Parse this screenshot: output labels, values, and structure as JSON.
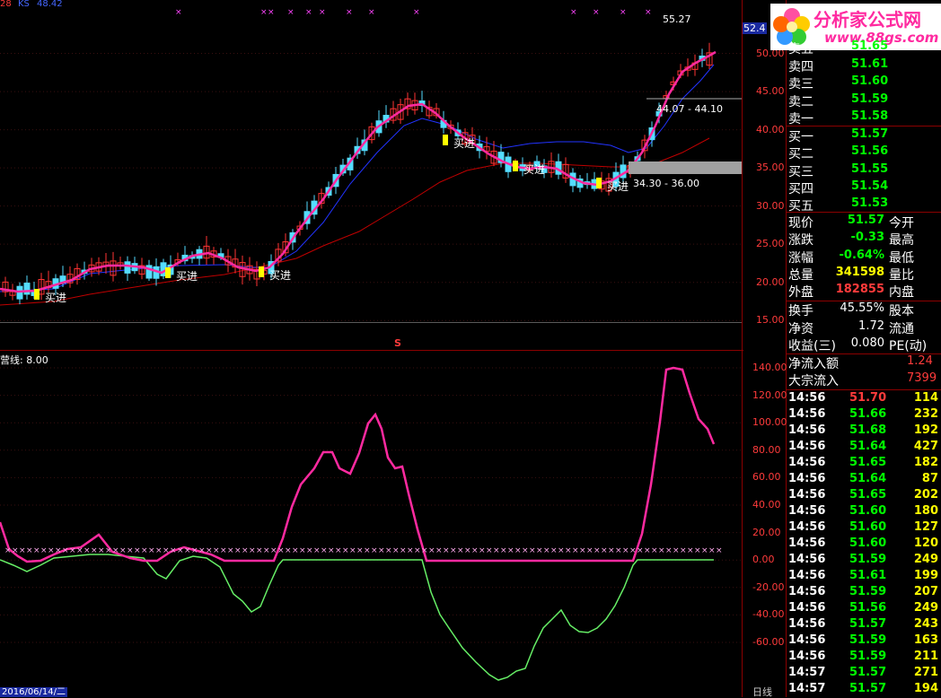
{
  "top_status": {
    "left_fragment": "28",
    "ks_label": "KS",
    "ks_value": "48.42"
  },
  "logo": {
    "brand": "分析家公式网",
    "url": "www.88gs.com"
  },
  "main_chart": {
    "y_ticks": [
      "50.00",
      "45.00",
      "40.00",
      "35.00",
      "30.00",
      "25.00",
      "20.00",
      "15.00"
    ],
    "y_range": [
      13.5,
      57
    ],
    "high_label": "55.27",
    "price_tag": "52.4",
    "annotations": [
      {
        "text": "44.07 - 44.10"
      },
      {
        "text": "34.30 - 36.00"
      }
    ],
    "buy_labels": [
      "买进",
      "买进",
      "买进",
      "买进",
      "买进",
      "买进"
    ],
    "marker": "S"
  },
  "order_book": {
    "asks": [
      {
        "label": "卖五",
        "price": "51.65"
      },
      {
        "label": "卖四",
        "price": "51.61"
      },
      {
        "label": "卖三",
        "price": "51.60"
      },
      {
        "label": "卖二",
        "price": "51.59"
      },
      {
        "label": "卖一",
        "price": "51.58"
      }
    ],
    "bids": [
      {
        "label": "买一",
        "price": "51.57"
      },
      {
        "label": "买二",
        "price": "51.56"
      },
      {
        "label": "买三",
        "price": "51.55"
      },
      {
        "label": "买四",
        "price": "51.54"
      },
      {
        "label": "买五",
        "price": "51.53"
      }
    ]
  },
  "stats": [
    {
      "label": "现价",
      "value": "51.57",
      "label2": "今开",
      "color": "#00ff00"
    },
    {
      "label": "涨跌",
      "value": "-0.33",
      "label2": "最高",
      "color": "#00ff00"
    },
    {
      "label": "涨幅",
      "value": "-0.64%",
      "label2": "最低",
      "color": "#00ff00"
    },
    {
      "label": "总量",
      "value": "341598",
      "label2": "量比",
      "color": "#ffff00"
    },
    {
      "label": "外盘",
      "value": "182855",
      "label2": "内盘",
      "color": "#ff3b3b"
    }
  ],
  "stats2": [
    {
      "label": "换手",
      "value": "45.55%",
      "label2": "股本",
      "color": "#ffffff"
    },
    {
      "label": "净资",
      "value": "1.72",
      "label2": "流通",
      "color": "#ffffff"
    },
    {
      "label": "收益(三)",
      "value": "0.080",
      "label2": "PE(动)",
      "color": "#ffffff"
    }
  ],
  "flow": [
    {
      "label": "净流入额",
      "value": "1.24"
    },
    {
      "label": "大宗流入",
      "value": "7399"
    }
  ],
  "trades": [
    {
      "time": "14:56",
      "price": "51.70",
      "vol": "114",
      "pc": "#ff3b3b",
      "vc": "#ffff00"
    },
    {
      "time": "14:56",
      "price": "51.66",
      "vol": "232",
      "pc": "#00ff00",
      "vc": "#ffff00"
    },
    {
      "time": "14:56",
      "price": "51.68",
      "vol": "192",
      "pc": "#00ff00",
      "vc": "#ffff00"
    },
    {
      "time": "14:56",
      "price": "51.64",
      "vol": "427",
      "pc": "#00ff00",
      "vc": "#ffff00"
    },
    {
      "time": "14:56",
      "price": "51.65",
      "vol": "182",
      "pc": "#00ff00",
      "vc": "#ffff00"
    },
    {
      "time": "14:56",
      "price": "51.64",
      "vol": "87",
      "pc": "#00ff00",
      "vc": "#ffff00"
    },
    {
      "time": "14:56",
      "price": "51.65",
      "vol": "202",
      "pc": "#00ff00",
      "vc": "#ffff00"
    },
    {
      "time": "14:56",
      "price": "51.60",
      "vol": "180",
      "pc": "#00ff00",
      "vc": "#ffff00"
    },
    {
      "time": "14:56",
      "price": "51.60",
      "vol": "127",
      "pc": "#00ff00",
      "vc": "#ffff00"
    },
    {
      "time": "14:56",
      "price": "51.60",
      "vol": "120",
      "pc": "#00ff00",
      "vc": "#ffff00"
    },
    {
      "time": "14:56",
      "price": "51.59",
      "vol": "249",
      "pc": "#00ff00",
      "vc": "#ffff00"
    },
    {
      "time": "14:56",
      "price": "51.61",
      "vol": "199",
      "pc": "#00ff00",
      "vc": "#ffff00"
    },
    {
      "time": "14:56",
      "price": "51.59",
      "vol": "207",
      "pc": "#00ff00",
      "vc": "#ffff00"
    },
    {
      "time": "14:56",
      "price": "51.56",
      "vol": "249",
      "pc": "#00ff00",
      "vc": "#ffff00"
    },
    {
      "time": "14:56",
      "price": "51.57",
      "vol": "243",
      "pc": "#00ff00",
      "vc": "#ffff00"
    },
    {
      "time": "14:56",
      "price": "51.59",
      "vol": "163",
      "pc": "#00ff00",
      "vc": "#ffff00"
    },
    {
      "time": "14:56",
      "price": "51.59",
      "vol": "211",
      "pc": "#00ff00",
      "vc": "#ffff00"
    },
    {
      "time": "14:57",
      "price": "51.57",
      "vol": "271",
      "pc": "#00ff00",
      "vc": "#ffff00"
    },
    {
      "time": "14:57",
      "price": "51.57",
      "vol": "194",
      "pc": "#00ff00",
      "vc": "#ffff00"
    }
  ],
  "indicator": {
    "label": "营线: 8.00",
    "y_ticks": [
      "140.00",
      "120.00",
      "100.00",
      "80.00",
      "60.00",
      "40.00",
      "20.00",
      "0.00",
      "-20.00",
      "-40.00",
      "-60.00"
    ],
    "y_range": [
      -88,
      152
    ],
    "baseline": 8
  },
  "bottom": {
    "date": "2016/06/14/二",
    "period": "日线"
  },
  "colors": {
    "frame": "#8b0000",
    "magenta": "#ff2aa0",
    "green": "#66ee66",
    "blue": "#2233ff",
    "red_ma": "#c00000",
    "up": "#ff3333",
    "down": "#55ddff",
    "buy": "#ffff00"
  }
}
